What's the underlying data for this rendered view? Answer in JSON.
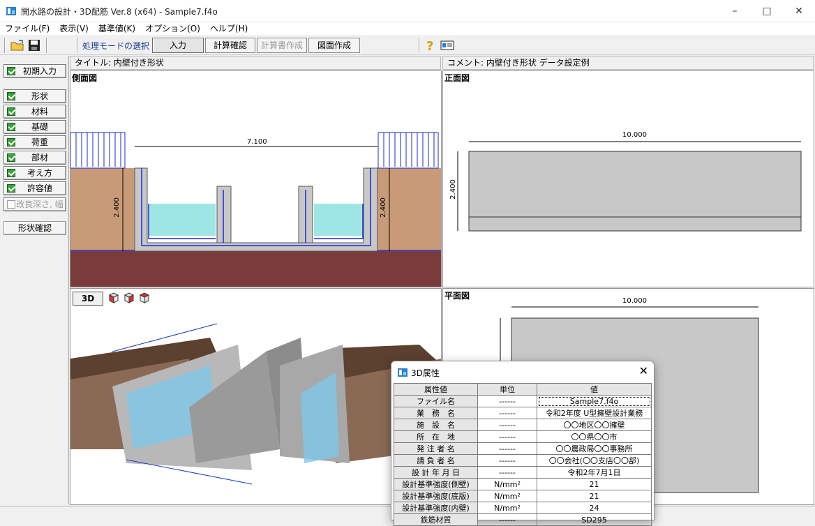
{
  "window": {
    "title": "開水路の設計・3D配筋 Ver.8 (x64) - Sample7.f4o"
  },
  "menu": [
    "ファイル(F)",
    "表示(V)",
    "基準値(K)",
    "オプション(O)",
    "ヘルプ(H)"
  ],
  "toolbar": {
    "mode_label": "処理モードの選択",
    "modes": [
      "入力",
      "計算確認",
      "計算書作成",
      "図面作成"
    ]
  },
  "sidebar": {
    "initial": "初期入力",
    "items": [
      "形状",
      "材料",
      "基礎",
      "荷重",
      "部材",
      "考え方",
      "許容値"
    ],
    "disabled_item": "改良深さ, 幅",
    "confirm": "形状確認"
  },
  "header": {
    "title": "タイトル: 内壁付き形状",
    "comment": "コメント: 内壁付き形状  データ設定例"
  },
  "views": {
    "side": {
      "label": "側面図",
      "width_dim": "7.100",
      "height_left": "2.400",
      "height_right": "2.400"
    },
    "front": {
      "label": "正面図",
      "width_dim": "10.000",
      "height_dim": "2.400"
    },
    "plan": {
      "label": "平面図",
      "width_dim": "10.000"
    },
    "view3d": {
      "button": "3D"
    }
  },
  "dialog": {
    "title": "3D属性",
    "columns": [
      "属性値",
      "単位",
      "値"
    ],
    "rows": [
      [
        "ファイル名",
        "------",
        "Sample7.f4o"
      ],
      [
        "業　務　名",
        "------",
        "令和2年度 U型擁壁設計業務"
      ],
      [
        "施　設　名",
        "------",
        "〇〇地区〇〇擁壁"
      ],
      [
        "所　在　地",
        "------",
        "〇〇県〇〇市"
      ],
      [
        "発 注 者 名",
        "------",
        "〇〇農政局〇〇事務所"
      ],
      [
        "請 負 者 名",
        "------",
        "〇〇会社(〇〇支店〇〇部)"
      ],
      [
        "設 計 年 月 日",
        "------",
        "令和2年7月1日"
      ],
      [
        "設計基準強度(側壁)",
        "N/mm²",
        "21"
      ],
      [
        "設計基準強度(底版)",
        "N/mm²",
        "21"
      ],
      [
        "設計基準強度(内壁)",
        "N/mm²",
        "24"
      ],
      [
        "鉄筋材質",
        "------",
        "SD295"
      ]
    ]
  }
}
